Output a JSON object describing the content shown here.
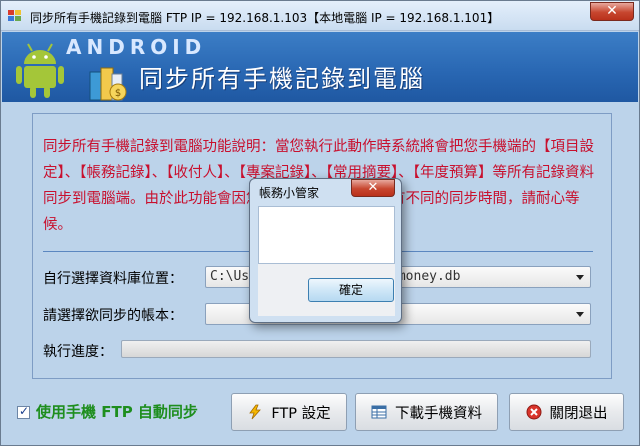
{
  "window": {
    "title": "同步所有手機記錄到電腦 FTP IP = 192.168.1.103【本地電腦 IP = 192.168.1.101】",
    "close_label": "✕"
  },
  "header": {
    "brand_text": "ANDROID",
    "title": "同步所有手機記錄到電腦"
  },
  "main": {
    "description": "同步所有手機記錄到電腦功能說明：當您執行此動作時系統將會把您手機端的【項目設定】、【帳務記錄】、【收付人】、【專案記錄】、【常用摘要】、【年度預算】等所有記錄資料同步到電腦端。由於此功能會因您的資料記錄的多寡而有不同的同步時間，請耐心等候。",
    "db_label": "自行選擇資料庫位置：",
    "db_value": "C:\\Users\\User\\Desktop\\mymoney.db",
    "account_label": "請選擇欲同步的帳本：",
    "account_value": "",
    "progress_label": "執行進度：",
    "progress_fraction": 0.0
  },
  "footer": {
    "checkbox_label": "使用手機 FTP 自動同步",
    "checkbox_checked": true,
    "ftp_button": "FTP 設定",
    "download_button": "下載手機資料",
    "close_button": "關閉退出"
  },
  "modal": {
    "title": "帳務小管家",
    "close_label": "✕",
    "message": "",
    "ok_button": "確定"
  },
  "colors": {
    "header_blue": "#2866b2",
    "panel_bg": "#bcd3ea",
    "description_red": "#c8102e",
    "checkbox_label_green": "#1e8e1e"
  }
}
